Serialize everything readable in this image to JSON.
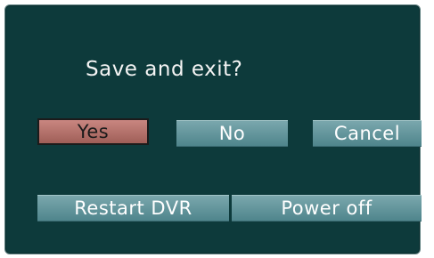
{
  "dialog": {
    "prompt": "Save and exit?",
    "buttons": {
      "yes": "Yes",
      "no": "No",
      "cancel": "Cancel",
      "restart": "Restart DVR",
      "power_off": "Power off"
    },
    "selected": "Yes"
  },
  "colors": {
    "background": "#0d3a3b",
    "button": "#5f949a",
    "button_selected": "#b77570",
    "text": "#ffffff"
  }
}
